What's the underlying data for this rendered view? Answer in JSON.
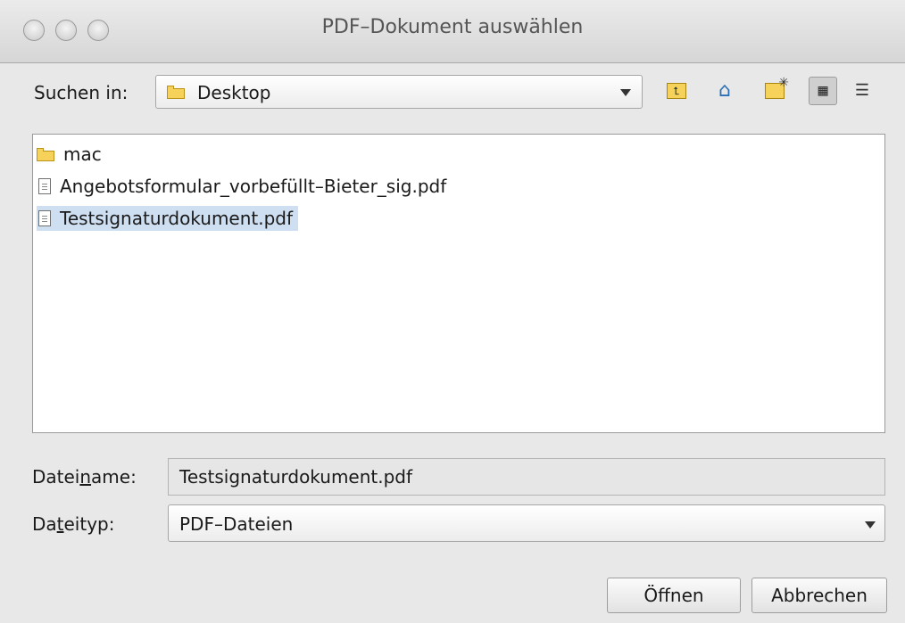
{
  "window": {
    "title": "PDF–Dokument auswählen"
  },
  "lookin": {
    "label": "Suchen in:",
    "value": "Desktop"
  },
  "toolbar": {
    "up_icon": "folder-up-icon",
    "home_icon": "home-icon",
    "new_folder_icon": "new-folder-icon",
    "list_view_icon": "list-view-icon",
    "details_view_icon": "details-view-icon"
  },
  "files": [
    {
      "name": "mac",
      "type": "folder"
    },
    {
      "name": "Angebotsformular_vorbefüllt–Bieter_sig.pdf",
      "type": "file"
    },
    {
      "name": "Testsignaturdokument.pdf",
      "type": "file",
      "selected": true
    }
  ],
  "filename": {
    "label_before": "Datei",
    "label_mnemonic": "n",
    "label_after": "ame:",
    "value": "Testsignaturdokument.pdf"
  },
  "filetype": {
    "label_before": "Da",
    "label_mnemonic": "t",
    "label_after": "eityp:",
    "value": "PDF–Dateien"
  },
  "buttons": {
    "open": "Öffnen",
    "cancel": "Abbrechen"
  },
  "colors": {
    "selection": "#cfdff2",
    "folder": "#f6d25a"
  }
}
